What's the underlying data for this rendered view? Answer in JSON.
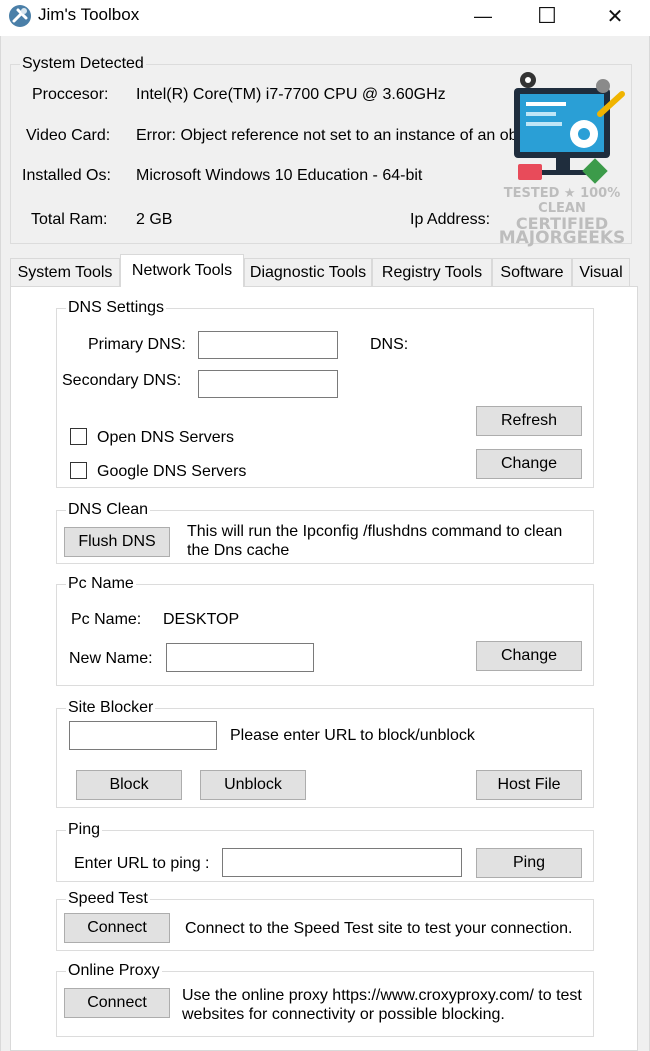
{
  "window": {
    "title": "Jim's Toolbox",
    "minimize_glyph": "—",
    "maximize_glyph": "☐",
    "close_glyph": "✕"
  },
  "system": {
    "group_title": "System Detected",
    "processor_label": "Proccesor:",
    "processor_value": "Intel(R) Core(TM) i7-7700 CPU @ 3.60GHz",
    "video_label": "Video Card:",
    "video_value": "Error: Object reference not set to an instance of an object.",
    "os_label": "Installed Os:",
    "os_value": "Microsoft Windows 10 Education - 64-bit",
    "ram_label": "Total Ram:",
    "ram_value": "2 GB",
    "ip_label": "Ip Address:"
  },
  "watermark": {
    "line1": "TESTED ★ 100% CLEAN",
    "line2": "CERTIFIED",
    "line3": "MAJORGEEKS"
  },
  "tabs": [
    {
      "label": "System Tools"
    },
    {
      "label": "Network Tools"
    },
    {
      "label": "Diagnostic Tools"
    },
    {
      "label": "Registry Tools"
    },
    {
      "label": "Software"
    },
    {
      "label": "Visual"
    }
  ],
  "dns": {
    "group_title": "DNS Settings",
    "primary_label": "Primary DNS:",
    "primary_value": "",
    "secondary_label": "Secondary DNS:",
    "secondary_value": "",
    "dns_label": "DNS:",
    "open_dns_label": "Open DNS Servers",
    "google_dns_label": "Google DNS Servers",
    "refresh_label": "Refresh",
    "change_label": "Change"
  },
  "dns_clean": {
    "group_title": "DNS Clean",
    "flush_label": "Flush DNS",
    "description": "This will run the Ipconfig /flushdns command to clean the Dns cache"
  },
  "pc_name": {
    "group_title": "Pc Name",
    "name_label": "Pc Name:",
    "name_value": "DESKTOP",
    "new_name_label": "New Name:",
    "new_name_value": "",
    "change_label": "Change"
  },
  "site_blocker": {
    "group_title": "Site Blocker",
    "url_value": "",
    "hint": "Please enter URL to block/unblock",
    "block_label": "Block",
    "unblock_label": "Unblock",
    "hostfile_label": "Host File"
  },
  "ping": {
    "group_title": "Ping",
    "url_label": "Enter URL to ping :",
    "url_value": "",
    "ping_label": "Ping"
  },
  "speed_test": {
    "group_title": "Speed Test",
    "connect_label": "Connect",
    "description": "Connect to the Speed Test site to test your connection."
  },
  "online_proxy": {
    "group_title": "Online Proxy",
    "connect_label": "Connect",
    "description": "Use the online proxy https://www.croxyproxy.com/ to test websites for connectivity or possible blocking."
  }
}
